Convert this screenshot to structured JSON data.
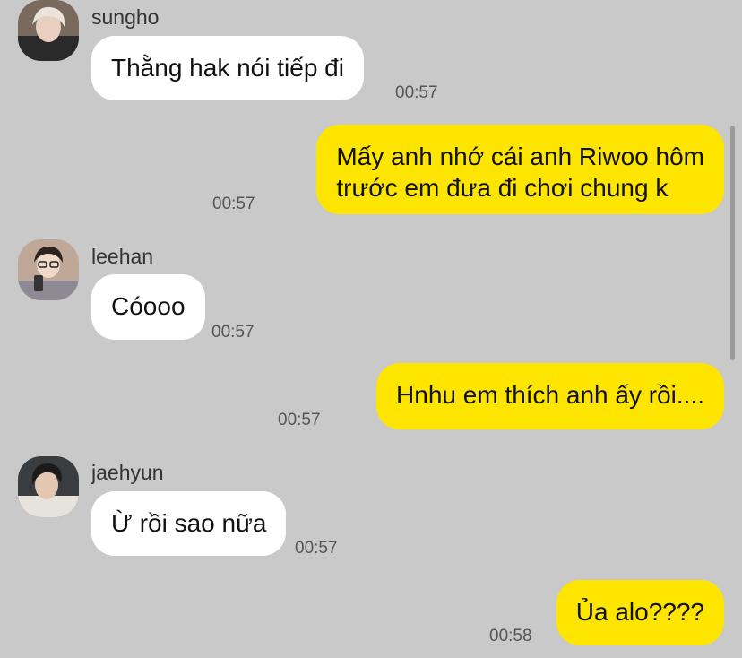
{
  "messages": [
    {
      "sender": "sungho",
      "text": "Thằng hak nói tiếp đi",
      "time": "00:57"
    },
    {
      "text": "Mấy anh nhớ cái anh Riwoo hôm\ntrước em đưa đi chơi chung k",
      "time": "00:57"
    },
    {
      "sender": "leehan",
      "text": "Cóooo",
      "time": "00:57"
    },
    {
      "text": "Hnhu em thích anh ấy rồi....",
      "time": "00:57"
    },
    {
      "sender": "jaehyun",
      "text": "Ừ rồi sao nữa",
      "time": "00:57"
    },
    {
      "text": "Ủa alo????",
      "time": "00:58"
    }
  ],
  "colors": {
    "background": "#c9c9c9",
    "incoming_bubble": "#ffffff",
    "outgoing_bubble": "#fee500"
  }
}
